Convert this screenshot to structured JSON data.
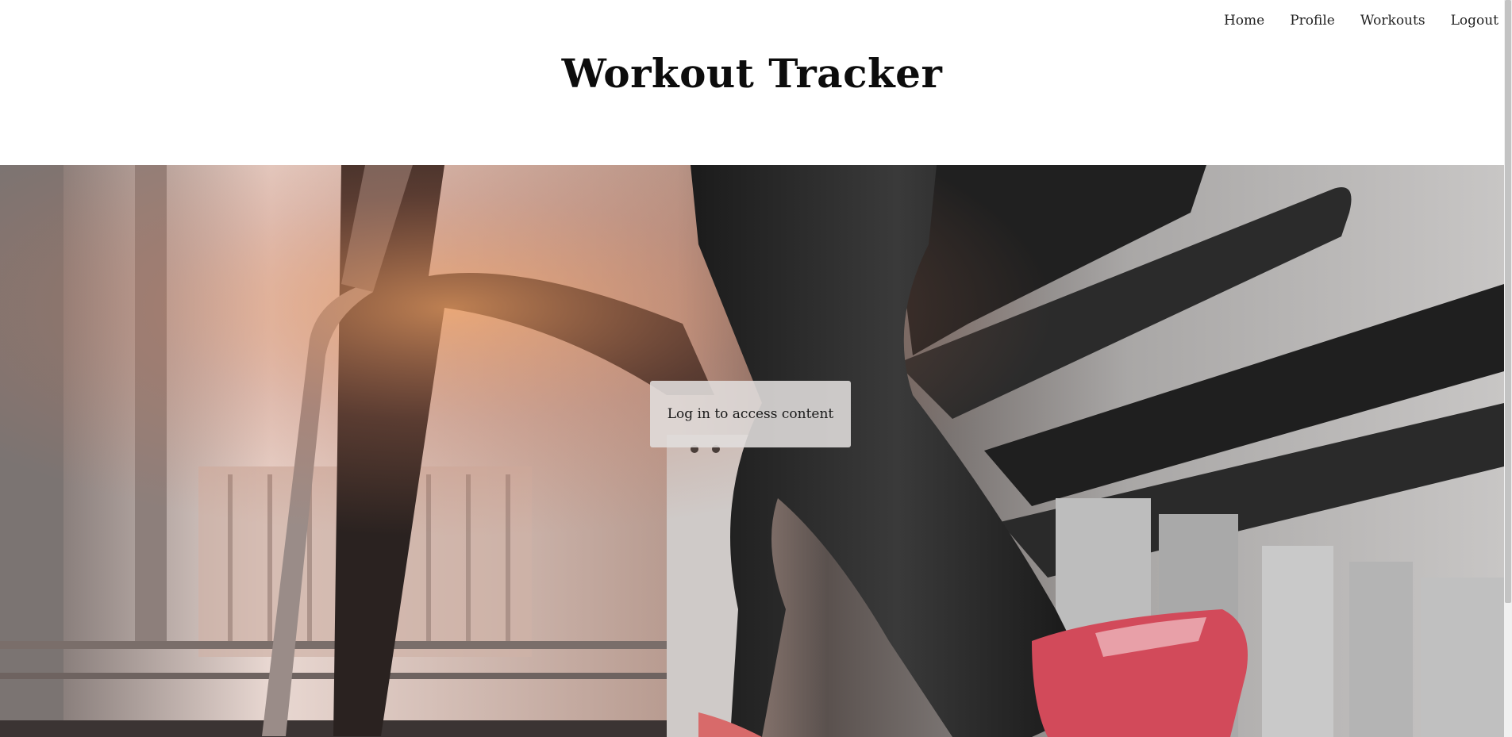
{
  "nav": {
    "items": [
      {
        "label": "Home"
      },
      {
        "label": "Profile"
      },
      {
        "label": "Workouts"
      },
      {
        "label": "Logout"
      }
    ]
  },
  "header": {
    "title": "Workout Tracker"
  },
  "hero": {
    "login_prompt": "Log in to access content"
  },
  "colors": {
    "background": "#ffffff",
    "title": "#0c0c0c",
    "login_box": "#e1dedd"
  }
}
